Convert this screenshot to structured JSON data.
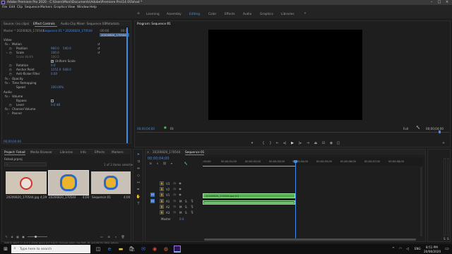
{
  "window": {
    "title": "Adobe Premiere Pro 2020 - C:\\Users\\Moni\\Documents\\Adobe\\Premiere Pro\\14.0\\Fahad *"
  },
  "menu": [
    "File",
    "Edit",
    "Clip",
    "Sequence",
    "Markers",
    "Graphics",
    "View",
    "Window",
    "Help"
  ],
  "workspaces": {
    "items": [
      "Learning",
      "Assembly",
      "Editing",
      "Color",
      "Effects",
      "Audio",
      "Graphics",
      "Libraries"
    ],
    "active": "Editing"
  },
  "source_panel": {
    "tabs": [
      "Source: (no clips)",
      "Effect Controls",
      "Audio Clip Mixer: Sequence 01",
      "Metadata"
    ],
    "active_tab": "Effect Controls",
    "master_label": "Master * 20200820_170544",
    "sequence_label": "Sequence 01 * 20200820_170544",
    "ruler_start": ":00:00",
    "ruler_end": "00:0",
    "clip_label": "20200820_170544",
    "sections": {
      "video": "Video",
      "motion": "Motion",
      "position_label": "Position",
      "position_x": "960.0",
      "position_y": "540.0",
      "scale_label": "Scale",
      "scale_value": "100.0",
      "scale_width_label": "Scale Width",
      "scale_width_value": "100.0",
      "uniform_scale": "Uniform Scale",
      "rotation_label": "Rotation",
      "rotation_value": "0.0",
      "anchor_label": "Anchor Point",
      "anchor_x": "1152.0",
      "anchor_y": "648.0",
      "antiflicker_label": "Anti-flicker Filter",
      "antiflicker_value": "0.00",
      "opacity": "Opacity",
      "time_remapping": "Time Remapping",
      "speed_label": "Speed",
      "speed_value": "100.00%",
      "audio": "Audio",
      "volume": "Volume",
      "bypass_label": "Bypass",
      "level_label": "Level",
      "level_value": "0.0 dB",
      "channel_volume": "Channel Volume",
      "panner": "Panner"
    },
    "timecode": "00;00;00;00"
  },
  "program_monitor": {
    "title": "Program: Sequence 01",
    "timecode": "00;00;04;00",
    "fit": "Fit",
    "quality": "Full",
    "duration": "00;00;04;00"
  },
  "project_panel": {
    "tabs": [
      "Project: Fahad",
      "Media Browser",
      "Libraries",
      "Info",
      "Effects",
      "Markers"
    ],
    "active_tab": "Project: Fahad",
    "project_file": "Fahad.prproj",
    "selection_info": "1 of 3 items selected",
    "items": [
      {
        "name": "20200820_170544.jpg",
        "duration": "4;29"
      },
      {
        "name": "20200820_170544",
        "duration": "4;00"
      },
      {
        "name": "Sequence 01",
        "duration": "4;00"
      }
    ]
  },
  "timeline": {
    "tabs": [
      "20200820_170544",
      "Sequence 01"
    ],
    "active_tab": "Sequence 01",
    "timecode": "00;00;04;00",
    "ruler": [
      ":00;00",
      "00;00;01;00",
      "00;00;02;00",
      "00;00;03;00",
      "00;00;04;00",
      "00;00;05;00",
      "00;00;06;00",
      "00;00;07;00",
      "00;00;08;00"
    ],
    "video_tracks": [
      "V3",
      "V2",
      "V1"
    ],
    "audio_tracks": [
      "A1",
      "A2",
      "A3"
    ],
    "master_label": "Master",
    "master_value": "0.0",
    "clip_label": "20200820_170544.jpg [V]"
  },
  "status_bar": {
    "text": "Click to select, or click in empty space and drag to marquee select. Use Shift, Alt, and Ctrl for other options."
  },
  "taskbar": {
    "search_placeholder": "Type here to search",
    "time": "8:51 PM",
    "date": "20/08/2020",
    "language": "ENG"
  },
  "colors": {
    "accent": "#3f8ce8",
    "clip_green": "#52b24f",
    "playhead": "#3f8ce8"
  }
}
